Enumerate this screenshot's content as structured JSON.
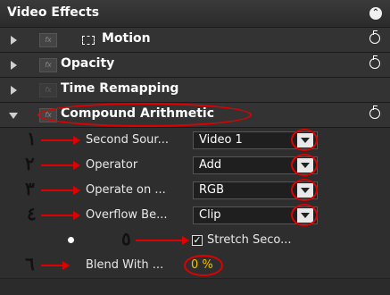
{
  "panel": {
    "title": "Video Effects"
  },
  "effects": [
    {
      "label": "Motion"
    },
    {
      "label": "Opacity"
    },
    {
      "label": "Time Remapping"
    },
    {
      "label": "Compound Arithmetic"
    }
  ],
  "params": [
    {
      "label": "Second Sour...",
      "value": "Video 1",
      "annotation": "١"
    },
    {
      "label": "Operator",
      "value": "Add",
      "annotation": "٢"
    },
    {
      "label": "Operate on ...",
      "value": "RGB",
      "annotation": "٣"
    },
    {
      "label": "Overflow Be...",
      "value": "Clip",
      "annotation": "٤"
    }
  ],
  "stretch": {
    "label": "Stretch Seco...",
    "checked": true,
    "annotation": "٥"
  },
  "blend": {
    "label": "Blend With ...",
    "value": "0 %",
    "annotation": "٦"
  },
  "colors": {
    "annotation_red": "#e10000",
    "value_yellow": "#f0c000"
  }
}
